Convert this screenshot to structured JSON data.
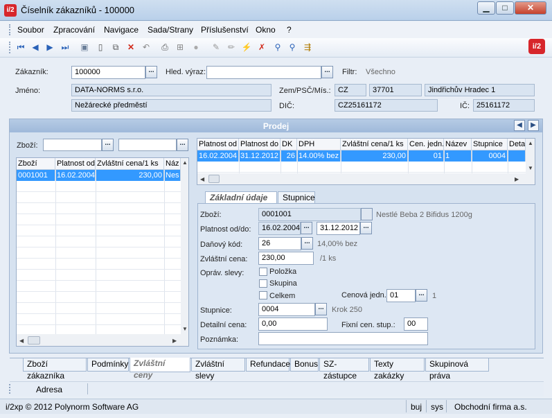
{
  "window": {
    "title": "Číselník zákazníků - 100000",
    "logo": "i/2"
  },
  "menu": [
    "Soubor",
    "Zpracování",
    "Navigace",
    "Sada/Strany",
    "Příslušenství",
    "Okno",
    "?"
  ],
  "toolbar_icons": [
    "first-record-icon",
    "prev-record-icon",
    "next-record-icon",
    "last-record-icon",
    "save-icon",
    "new-icon",
    "copy-icon",
    "delete-icon",
    "undo-icon",
    "print-icon",
    "tree-icon",
    "disabled-icon",
    "edit-icon",
    "pencil-icon",
    "filter-icon",
    "clear-filter-icon",
    "search-icon",
    "find-next-icon",
    "export-icon"
  ],
  "header": {
    "zakaznik_label": "Zákazník:",
    "zakaznik_value": "100000",
    "hled_label": "Hled. výraz:",
    "hled_value": "",
    "filtr_label": "Filtr:",
    "filtr_value": "Všechno",
    "jmeno_label": "Jméno:",
    "jmeno1": "DATA-NORMS s.r.o.",
    "jmeno2": "Nežárecké předměstí",
    "zem_label": "Zem/PSČ/Mís.:",
    "zem": "CZ",
    "psc": "37701",
    "misto": "Jindřichův Hradec 1",
    "dic_label": "DIČ:",
    "dic": "CZ25161172",
    "ic_label": "IČ:",
    "ic": "25161172"
  },
  "panel": {
    "title": "Prodej",
    "zbozi_label": "Zboží:",
    "left_grid": {
      "headers": [
        "Zboží",
        "Platnost od",
        "Zvláštní cena/1 ks",
        "Náz"
      ],
      "rows": [
        [
          "0001001",
          "16.02.2004",
          "230,00",
          "Nes"
        ]
      ]
    },
    "right_grid": {
      "headers": [
        "Platnost od",
        "Platnost do",
        "DK",
        "DPH",
        "Zvláštní cena/1 ks",
        "Cen. jedn.",
        "Název",
        "Stupnice",
        "Deta"
      ],
      "rows": [
        [
          "16.02.2004",
          "31.12.2012",
          "26",
          "14.00% bez",
          "230,00",
          "01",
          "1",
          "0004",
          ""
        ]
      ]
    },
    "detail_tabs": [
      "Základní údaje",
      "Stupnice"
    ],
    "detail": {
      "zbozi_label": "Zboží:",
      "zbozi_value": "0001001",
      "zbozi_name": "Nestlé Beba 2 Bifidus 1200g",
      "platnost_label": "Platnost od/do:",
      "platnost_od": "16.02.2004",
      "platnost_do": "31.12.2012",
      "danovy_label": "Daňový kód:",
      "danovy_value": "26",
      "danovy_desc": "14,00% bez",
      "cena_label": "Zvláštní cena:",
      "cena_value": "230,00",
      "cena_unit": "/1 ks",
      "slevy_label": "Opráv. slevy:",
      "polozka": "Položka",
      "skupina": "Skupina",
      "celkem": "Celkem",
      "cen_jedn_label": "Cenová jedn.",
      "cen_jedn_value": "01",
      "cen_jedn_extra": "1",
      "stupnice_label": "Stupnice:",
      "stupnice_value": "0004",
      "stupnice_desc": "Krok 250",
      "detailni_label": "Detailní cena:",
      "detailni_value": "0,00",
      "fixni_label": "Fixní cen. stup.:",
      "fixni_value": "00",
      "poznamka_label": "Poznámka:",
      "poznamka_value": ""
    }
  },
  "bottom_tabs": [
    "Zboží zákazníka",
    "Podmínky",
    "Zvláštní ceny",
    "Zvláštní slevy",
    "Refundace",
    "Bonus",
    "SZ-zástupce",
    "Texty zakázky",
    "Skupinová práva"
  ],
  "adresa": "Adresa",
  "status": {
    "copyright": "i/2xp © 2012 Polynorm Software AG",
    "user": "buj",
    "sys": "sys",
    "firm": "Obchodní firma a.s."
  }
}
